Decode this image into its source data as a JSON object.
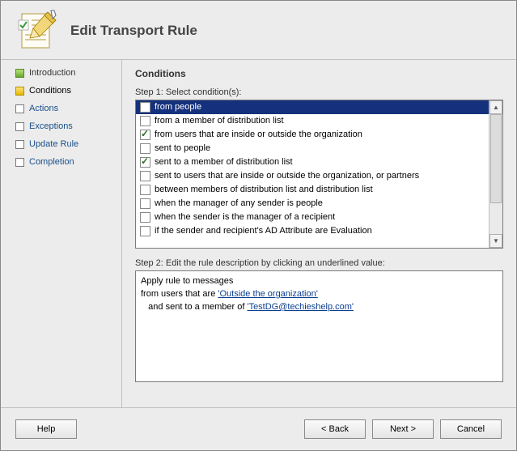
{
  "header": {
    "title": "Edit Transport Rule"
  },
  "sidebar": {
    "items": [
      {
        "label": "Introduction",
        "box": "green"
      },
      {
        "label": "Conditions",
        "box": "yellow"
      },
      {
        "label": "Actions",
        "box": "gray"
      },
      {
        "label": "Exceptions",
        "box": "gray"
      },
      {
        "label": "Update Rule",
        "box": "gray"
      },
      {
        "label": "Completion",
        "box": "gray"
      }
    ]
  },
  "main": {
    "title": "Conditions",
    "step1_label": "Step 1: Select condition(s):",
    "step2_label": "Step 2: Edit the rule description by clicking an underlined value:",
    "conditions": [
      {
        "label": "from people",
        "checked": false,
        "selected": true
      },
      {
        "label": "from a member of distribution list",
        "checked": false
      },
      {
        "label": "from users that are inside or outside the organization",
        "checked": true
      },
      {
        "label": "sent to people",
        "checked": false
      },
      {
        "label": "sent to a member of distribution list",
        "checked": true
      },
      {
        "label": "sent to users that are inside or outside the organization, or partners",
        "checked": false
      },
      {
        "label": "between members of distribution list and distribution list",
        "checked": false
      },
      {
        "label": "when the manager of any sender is people",
        "checked": false
      },
      {
        "label": "when the sender is the manager of a recipient",
        "checked": false
      },
      {
        "label": "if the sender and recipient's AD Attribute are Evaluation",
        "checked": false
      }
    ],
    "description": {
      "line1": "Apply rule to messages",
      "line2_prefix": "from users that are ",
      "line2_link": "'Outside the organization'",
      "line3_prefix": "   and sent to a member of ",
      "line3_link": "'TestDG@techieshelp.com'"
    }
  },
  "footer": {
    "help": "Help",
    "back": "< Back",
    "next": "Next >",
    "cancel": "Cancel"
  }
}
